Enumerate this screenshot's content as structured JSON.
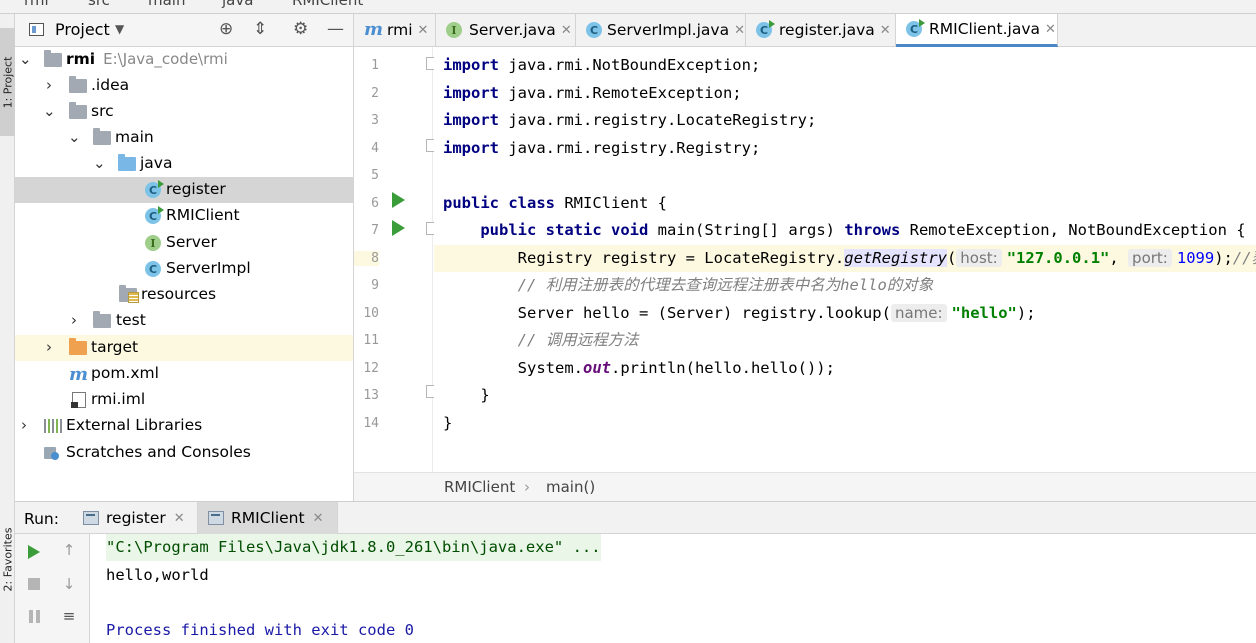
{
  "top_breadcrumb": {
    "items": [
      "rmi",
      "src",
      "main",
      "java",
      "RMIClient"
    ]
  },
  "tool_stripe": {
    "project_tab": "1: Project",
    "favorites_tab": "2: Favorites"
  },
  "project_panel": {
    "title": "Project",
    "tree": [
      {
        "label": "rmi",
        "sublabel": "E:\\Java_code\\rmi",
        "icon": "folder-icon",
        "expanded": true
      },
      {
        "label": ".idea",
        "icon": "folder-icon",
        "expanded": false
      },
      {
        "label": "src",
        "icon": "folder-icon",
        "expanded": true
      },
      {
        "label": "main",
        "icon": "folder-icon",
        "expanded": true
      },
      {
        "label": "java",
        "icon": "source-folder-icon",
        "expanded": true
      },
      {
        "label": "register",
        "icon": "class-runnable-icon",
        "selected": true
      },
      {
        "label": "RMIClient",
        "icon": "class-runnable-icon"
      },
      {
        "label": "Server",
        "icon": "interface-icon"
      },
      {
        "label": "ServerImpl",
        "icon": "class-icon"
      },
      {
        "label": "resources",
        "icon": "resources-folder-icon"
      },
      {
        "label": "test",
        "icon": "folder-icon",
        "expanded": false
      },
      {
        "label": "target",
        "icon": "excluded-folder-icon",
        "expanded": false
      },
      {
        "label": "pom.xml",
        "icon": "maven-icon"
      },
      {
        "label": "rmi.iml",
        "icon": "iml-file-icon"
      },
      {
        "label": "External Libraries",
        "icon": "library-icon",
        "expanded": false
      },
      {
        "label": "Scratches and Consoles",
        "icon": "scratch-icon"
      }
    ]
  },
  "editor_tabs": [
    {
      "label": "rmi",
      "icon": "maven-icon",
      "active": false
    },
    {
      "label": "Server.java",
      "icon": "interface-icon",
      "active": false
    },
    {
      "label": "ServerImpl.java",
      "icon": "class-icon",
      "active": false
    },
    {
      "label": "register.java",
      "icon": "class-runnable-icon",
      "active": false
    },
    {
      "label": "RMIClient.java",
      "icon": "class-runnable-icon",
      "active": true
    }
  ],
  "code": {
    "line_numbers": [
      "1",
      "2",
      "3",
      "4",
      "5",
      "6",
      "7",
      "8",
      "9",
      "10",
      "11",
      "12",
      "13",
      "14"
    ],
    "current_line": 8,
    "imports": [
      {
        "kw": "import",
        "text": " java.rmi.NotBoundException;"
      },
      {
        "kw": "import",
        "text": " java.rmi.RemoteException;"
      },
      {
        "kw": "import",
        "text": " java.rmi.registry.LocateRegistry;"
      },
      {
        "kw": "import",
        "text": " java.rmi.registry.Registry;"
      }
    ],
    "line6": {
      "kw1": "public",
      "kw2": "class",
      "rest": " RMIClient {"
    },
    "line7": {
      "kw1": "public",
      "kw2": "static",
      "kw3": "void",
      "mid": " main(String[] args) ",
      "kw4": "throws",
      "rest": " RemoteException, NotBoundException {"
    },
    "line8": {
      "pre": "Registry registry = LocateRegistry.",
      "method": "getRegistry",
      "paren": "(",
      "hint1": "host:",
      "str1": "\"127.0.0.1\"",
      "comma": ", ",
      "hint2": "port:",
      "num": "1099",
      "post": ");",
      "comment": "//获取"
    },
    "line9": {
      "comment": "// 利用注册表的代理去查询远程注册表中名为hello的对象"
    },
    "line10": {
      "pre": "Server hello = (Server) registry.lookup(",
      "hint": "name:",
      "str": "\"hello\"",
      "post": ");"
    },
    "line11": {
      "comment": "// 调用远程方法"
    },
    "line12": {
      "pre": "System.",
      "field": "out",
      "post": ".println(hello.hello());"
    },
    "line13": {
      "text": "}"
    },
    "line14": {
      "text": "}"
    }
  },
  "editor_breadcrumb": [
    "RMIClient",
    "main()"
  ],
  "run_panel": {
    "label": "Run:",
    "tabs": [
      {
        "label": "register",
        "active": false
      },
      {
        "label": "RMIClient",
        "active": true
      }
    ],
    "console": [
      "\"C:\\Program Files\\Java\\jdk1.8.0_261\\bin\\java.exe\" ...",
      "hello,world",
      "",
      "Process finished with exit code 0"
    ]
  }
}
